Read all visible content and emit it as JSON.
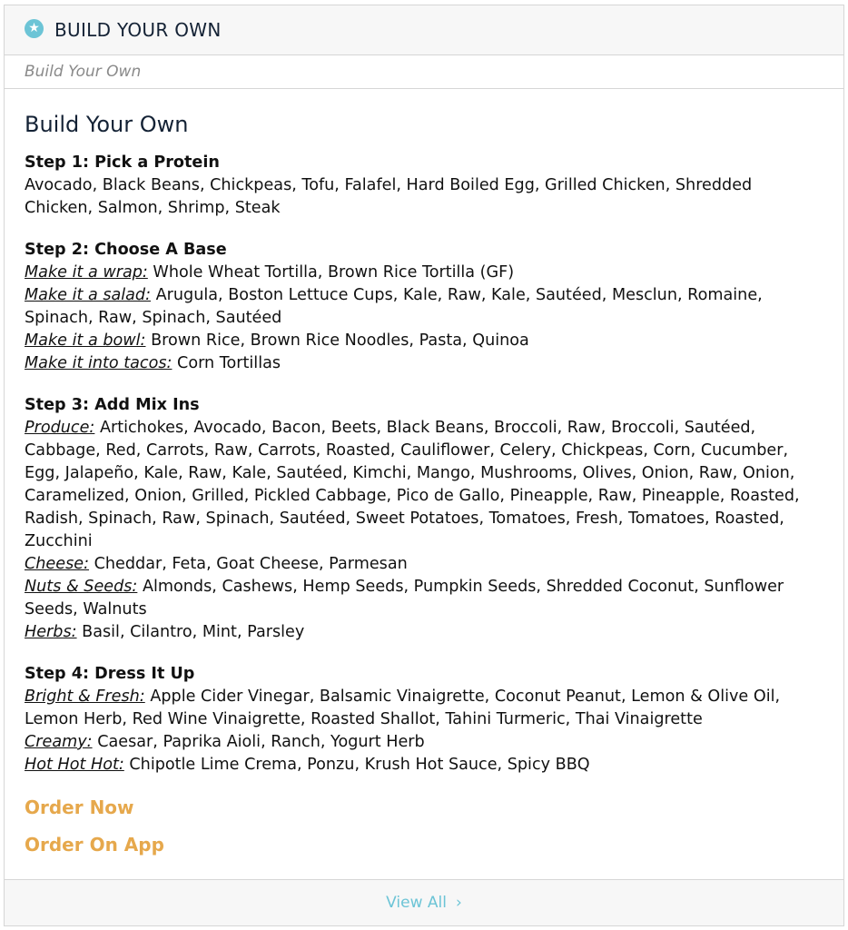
{
  "header": {
    "icon": "star-icon",
    "title": "BUILD YOUR OWN"
  },
  "breadcrumb": "Build Your Own",
  "main": {
    "title": "Build Your Own",
    "steps": [
      {
        "title": "Step 1: Pick a Protein",
        "lines": [
          {
            "label": "",
            "text": "Avocado, Black Beans, Chickpeas, Tofu, Falafel, Hard Boiled Egg, Grilled Chicken, Shredded Chicken, Salmon, Shrimp, Steak"
          }
        ]
      },
      {
        "title": "Step 2: Choose A Base",
        "lines": [
          {
            "label": "Make it a wrap:",
            "text": "Whole Wheat Tortilla, Brown Rice Tortilla (GF)"
          },
          {
            "label": "Make it a salad:",
            "text": "Arugula, Boston Lettuce Cups, Kale, Raw, Kale, Sautéed, Mesclun, Romaine, Spinach, Raw, Spinach, Sautéed"
          },
          {
            "label": "Make it a bowl:",
            "text": "Brown Rice, Brown Rice Noodles, Pasta, Quinoa"
          },
          {
            "label": "Make it into tacos:",
            "text": "Corn Tortillas"
          }
        ]
      },
      {
        "title": "Step 3: Add Mix Ins",
        "lines": [
          {
            "label": "Produce:",
            "text": "Artichokes, Avocado, Bacon, Beets, Black Beans, Broccoli, Raw, Broccoli, Sautéed, Cabbage, Red, Carrots, Raw, Carrots, Roasted, Cauliflower, Celery, Chickpeas, Corn, Cucumber, Egg, Jalapeño, Kale, Raw, Kale, Sautéed, Kimchi, Mango, Mushrooms, Olives, Onion, Raw, Onion, Caramelized, Onion, Grilled, Pickled Cabbage, Pico de Gallo, Pineapple, Raw, Pineapple, Roasted, Radish, Spinach, Raw, Spinach, Sautéed, Sweet Potatoes, Tomatoes, Fresh, Tomatoes, Roasted, Zucchini"
          },
          {
            "label": "Cheese:",
            "text": "Cheddar, Feta, Goat Cheese, Parmesan"
          },
          {
            "label": "Nuts & Seeds:",
            "text": "Almonds, Cashews, Hemp Seeds, Pumpkin Seeds, Shredded Coconut, Sunflower Seeds, Walnuts"
          },
          {
            "label": "Herbs:",
            "text": "Basil, Cilantro, Mint, Parsley"
          }
        ]
      },
      {
        "title": "Step 4: Dress It Up",
        "lines": [
          {
            "label": "Bright & Fresh:",
            "text": "Apple Cider Vinegar, Balsamic Vinaigrette, Coconut Peanut, Lemon & Olive Oil, Lemon Herb, Red Wine Vinaigrette, Roasted Shallot, Tahini Turmeric, Thai Vinaigrette"
          },
          {
            "label": "Creamy:",
            "text": "Caesar, Paprika Aioli, Ranch, Yogurt Herb"
          },
          {
            "label": "Hot Hot Hot:",
            "text": "Chipotle Lime Crema, Ponzu, Krush Hot Sauce, Spicy BBQ"
          }
        ]
      }
    ],
    "order_now": "Order Now",
    "order_on_app": "Order On App"
  },
  "footer": {
    "view_all": "View All",
    "chevron_icon": "chevron-right-icon"
  },
  "colors": {
    "accent": "#6cc4d6",
    "order": "#e6a84c",
    "heading": "#142235"
  }
}
